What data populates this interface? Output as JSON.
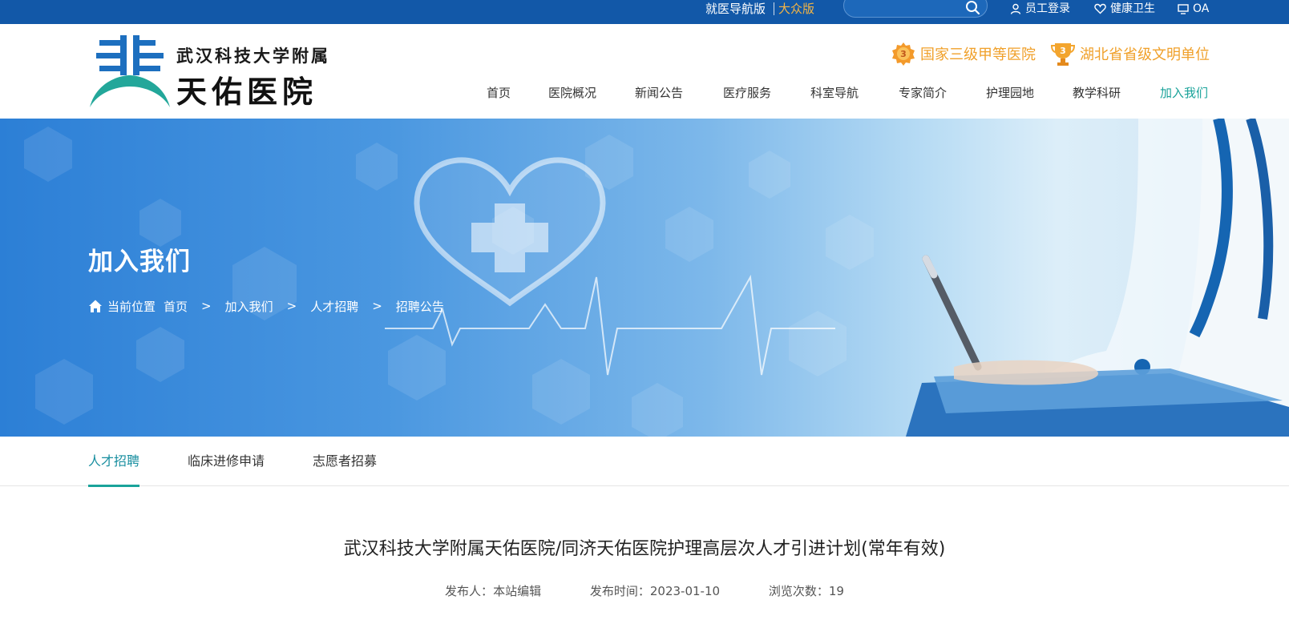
{
  "topbar": {
    "nav_guide": "就医导航版",
    "public_version": "大众版",
    "search_placeholder": "",
    "links": [
      {
        "label": "员工登录",
        "icon": "user-icon"
      },
      {
        "label": "健康卫生",
        "icon": "heart-icon"
      },
      {
        "label": "OA",
        "icon": "monitor-icon"
      }
    ],
    "colors": {
      "bar": "#1258a8",
      "highlight": "#f5b544"
    }
  },
  "header": {
    "logo": {
      "line1": "武汉科技大学附属",
      "line2": "天佑医院"
    },
    "honors": [
      {
        "label": "国家三级甲等医院",
        "badge": "3"
      },
      {
        "label": "湖北省省级文明单位",
        "badge": "3"
      }
    ],
    "nav": [
      "首页",
      "医院概况",
      "新闻公告",
      "医疗服务",
      "科室导航",
      "专家简介",
      "护理园地",
      "教学科研",
      "加入我们"
    ],
    "active_nav": "加入我们",
    "colors": {
      "accent": "#1aa39a",
      "honor": "#f0a02a"
    }
  },
  "banner": {
    "title": "加入我们",
    "breadcrumb_label": "当前位置",
    "breadcrumb": [
      "首页",
      "加入我们",
      "人才招聘",
      "招聘公告"
    ],
    "separator": ">"
  },
  "subtabs": {
    "items": [
      "人才招聘",
      "临床进修申请",
      "志愿者招募"
    ],
    "active": "人才招聘"
  },
  "article": {
    "title": "武汉科技大学附属天佑医院/同济天佑医院护理高层次人才引进计划(常年有效)",
    "publisher_label": "发布人：",
    "publisher": "本站编辑",
    "date_label": "发布时间：",
    "date": "2023-01-10",
    "views_label": "浏览次数：",
    "views": "19"
  }
}
